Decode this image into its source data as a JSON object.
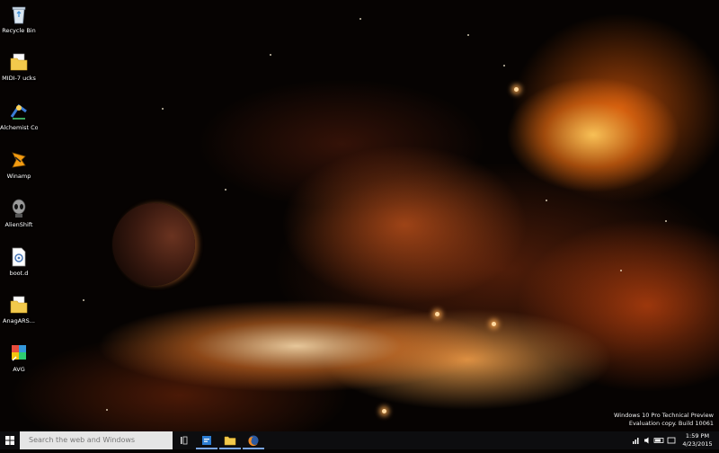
{
  "desktop": {
    "icons": [
      {
        "name": "recycle-bin",
        "label": "Recycle Bin",
        "icon": "recycle-bin-icon"
      },
      {
        "name": "mirror-folder",
        "label": "MIDI-7 ucks",
        "icon": "folder-icon"
      },
      {
        "name": "alchemist-compose",
        "label": "Alchemist Composo",
        "icon": "app-icon"
      },
      {
        "name": "winamp",
        "label": "Winamp",
        "icon": "winamp-icon"
      },
      {
        "name": "alien-game",
        "label": "AlienShift",
        "icon": "alien-icon"
      },
      {
        "name": "batch-file",
        "label": "boot.d",
        "icon": "file-gear-icon"
      },
      {
        "name": "archive-folder",
        "label": "AnagARS...",
        "icon": "folder-icon"
      },
      {
        "name": "avg",
        "label": "AVG",
        "icon": "avg-icon"
      }
    ]
  },
  "taskbar": {
    "search_placeholder": "Search the web and Windows",
    "apps": [
      {
        "name": "task-view",
        "icon": "task-view-icon"
      },
      {
        "name": "store",
        "icon": "store-icon"
      },
      {
        "name": "file-explorer",
        "icon": "folder-icon"
      },
      {
        "name": "firefox",
        "icon": "firefox-icon"
      }
    ],
    "clock_time": "1:59 PM",
    "clock_date": "4/23/2015"
  },
  "watermark": {
    "line1": "Windows 10 Pro Technical Preview",
    "line2": "Evaluation copy. Build 10061"
  },
  "colors": {
    "taskbar": "#0d0d0f",
    "search_box": "#e5e5e5",
    "accent": "#7aa6e6"
  }
}
